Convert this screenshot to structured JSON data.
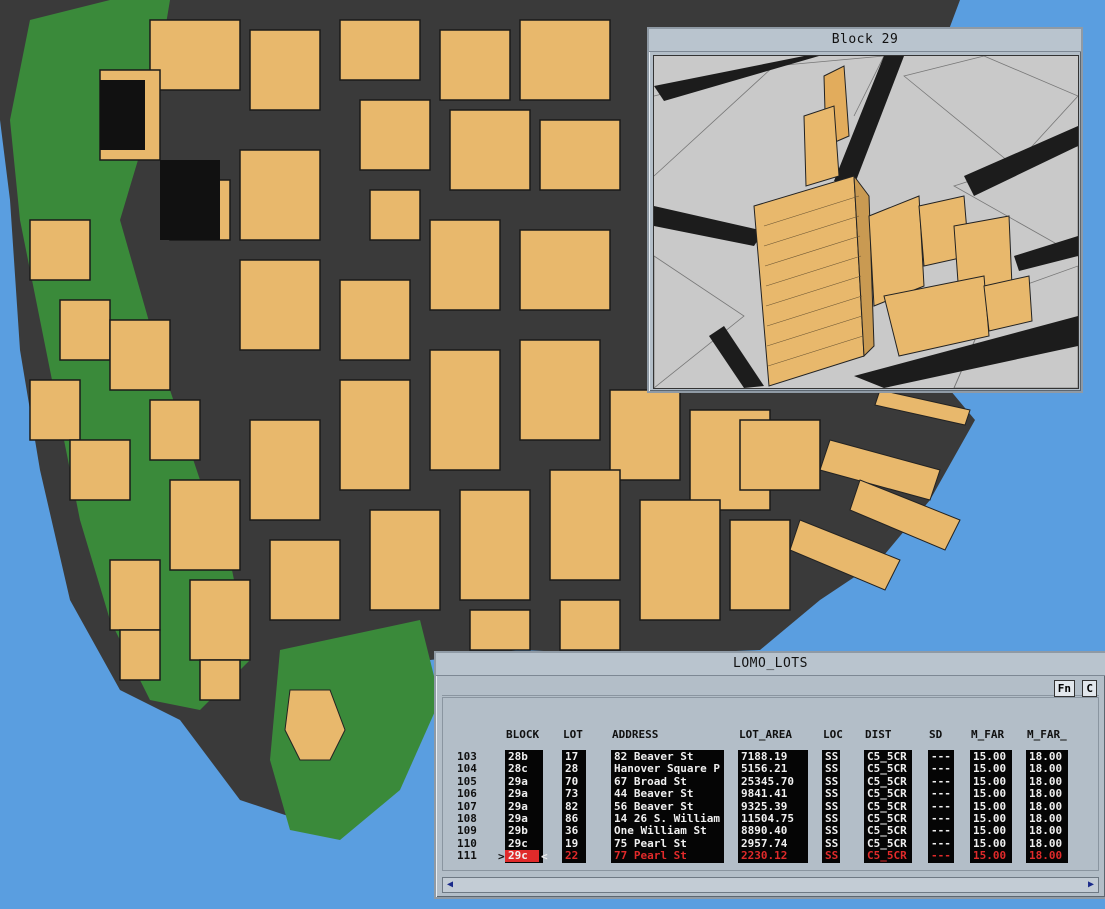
{
  "block_window": {
    "title": "Block 29"
  },
  "lots_window": {
    "title": "LOMO_LOTS",
    "buttons": {
      "fn": "Fn",
      "c": "C"
    },
    "columns": [
      "BLOCK",
      "LOT",
      "ADDRESS",
      "LOT_AREA",
      "LOC",
      "DIST",
      "SD",
      "M_FAR",
      "M_FAR_"
    ],
    "selected_markers": {
      "left": ">",
      "right": "<"
    },
    "rows": [
      {
        "no": "103",
        "block": "28b",
        "lot": "17",
        "address": "82 Beaver St",
        "lot_area": "7188.19",
        "loc": "SS",
        "dist": "C5_5CR",
        "sd": "---",
        "m_far": "15.00",
        "m_far2": "18.00"
      },
      {
        "no": "104",
        "block": "28c",
        "lot": "28",
        "address": "Hanover Square P",
        "lot_area": "5156.21",
        "loc": "SS",
        "dist": "C5_5CR",
        "sd": "---",
        "m_far": "15.00",
        "m_far2": "18.00"
      },
      {
        "no": "105",
        "block": "29a",
        "lot": "70",
        "address": "67 Broad St",
        "lot_area": "25345.70",
        "loc": "SS",
        "dist": "C5_5CR",
        "sd": "---",
        "m_far": "15.00",
        "m_far2": "18.00"
      },
      {
        "no": "106",
        "block": "29a",
        "lot": "73",
        "address": "44 Beaver St",
        "lot_area": "9841.41",
        "loc": "SS",
        "dist": "C5_5CR",
        "sd": "---",
        "m_far": "15.00",
        "m_far2": "18.00"
      },
      {
        "no": "107",
        "block": "29a",
        "lot": "82",
        "address": "56 Beaver St",
        "lot_area": "9325.39",
        "loc": "SS",
        "dist": "C5_5CR",
        "sd": "---",
        "m_far": "15.00",
        "m_far2": "18.00"
      },
      {
        "no": "108",
        "block": "29a",
        "lot": "86",
        "address": "14 26 S. William",
        "lot_area": "11504.75",
        "loc": "SS",
        "dist": "C5_5CR",
        "sd": "---",
        "m_far": "15.00",
        "m_far2": "18.00"
      },
      {
        "no": "109",
        "block": "29b",
        "lot": "36",
        "address": "One William St",
        "lot_area": "8890.40",
        "loc": "SS",
        "dist": "C5_5CR",
        "sd": "---",
        "m_far": "15.00",
        "m_far2": "18.00"
      },
      {
        "no": "110",
        "block": "29c",
        "lot": "19",
        "address": "75 Pearl St",
        "lot_area": "2957.74",
        "loc": "SS",
        "dist": "C5_5CR",
        "sd": "---",
        "m_far": "15.00",
        "m_far2": "18.00"
      },
      {
        "no": "111",
        "block": "29c",
        "lot": "22",
        "address": "77 Pearl St",
        "lot_area": "2230.12",
        "loc": "SS",
        "dist": "C5_5CR",
        "sd": "---",
        "m_far": "15.00",
        "m_far2": "18.00",
        "selected": true
      }
    ]
  },
  "colors": {
    "water": "#5a9ee0",
    "building": "#e8b86c",
    "park": "#3a8a3a",
    "street": "#2c2c2c",
    "selected": "#e02a2a"
  }
}
